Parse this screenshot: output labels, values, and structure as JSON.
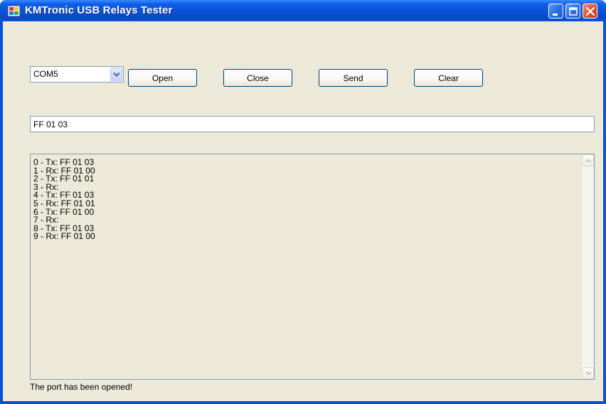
{
  "window": {
    "title": "KMTronic USB Relays Tester",
    "title_bar_color": "#0a50d8",
    "client_bg_color": "#ece9d8",
    "controls": [
      "minimize-icon",
      "maximize-icon",
      "close-icon"
    ]
  },
  "port_select": {
    "selected": "COM5",
    "icon": "chevron-down-icon"
  },
  "toolbar": {
    "open_label": "Open",
    "close_label": "Close",
    "send_label": "Send",
    "clear_label": "Clear"
  },
  "command_input": {
    "value": "FF 01 03"
  },
  "log": {
    "lines": [
      "0 - Tx: FF 01 03",
      "1 - Rx: FF 01 00",
      "2 - Tx: FF 01 01",
      "3 - Rx:",
      "4 - Tx: FF 01 03",
      "5 - Rx: FF 01 01",
      "6 - Tx: FF 01 00",
      "7 - Rx:",
      "8 - Tx: FF 01 03",
      "9 - Rx: FF 01 00"
    ]
  },
  "status": {
    "text": "The port has been opened!"
  }
}
